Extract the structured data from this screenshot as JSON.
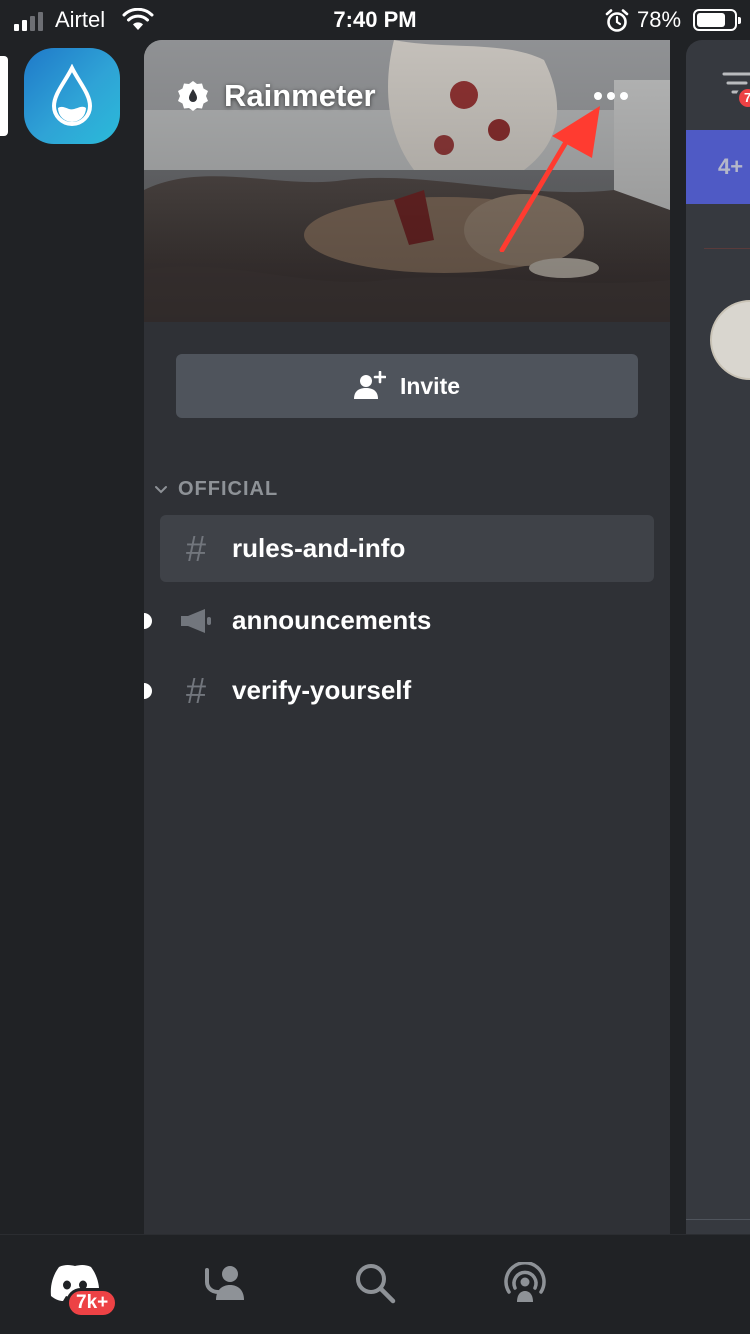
{
  "status_bar": {
    "carrier": "Airtel",
    "time": "7:40 PM",
    "battery_percent": "78%"
  },
  "server": {
    "name": "Rainmeter",
    "icon": "water-drop-icon"
  },
  "invite": {
    "label": "Invite",
    "icon": "add-person-icon"
  },
  "categories": [
    {
      "label": "OFFICIAL",
      "channels": [
        {
          "name": "rules-and-info",
          "type": "text",
          "icon": "hash-icon",
          "selected": true,
          "unread": false
        },
        {
          "name": "announcements",
          "type": "announcement",
          "icon": "megaphone-icon",
          "selected": false,
          "unread": true
        },
        {
          "name": "verify-yourself",
          "type": "text",
          "icon": "hash-icon",
          "selected": false,
          "unread": true
        }
      ]
    }
  ],
  "peek": {
    "band_text": "4+",
    "badge": "7"
  },
  "tabbar": {
    "tabs": [
      {
        "icon": "discord-home-icon",
        "badge": "7k+"
      },
      {
        "icon": "friends-icon"
      },
      {
        "icon": "search-icon"
      },
      {
        "icon": "mentions-icon"
      }
    ]
  },
  "colors": {
    "background": "#202225",
    "panel": "#2f3136",
    "accent": "#5865f2",
    "badge": "#ed4245",
    "annotation_arrow": "#ff3b30"
  }
}
